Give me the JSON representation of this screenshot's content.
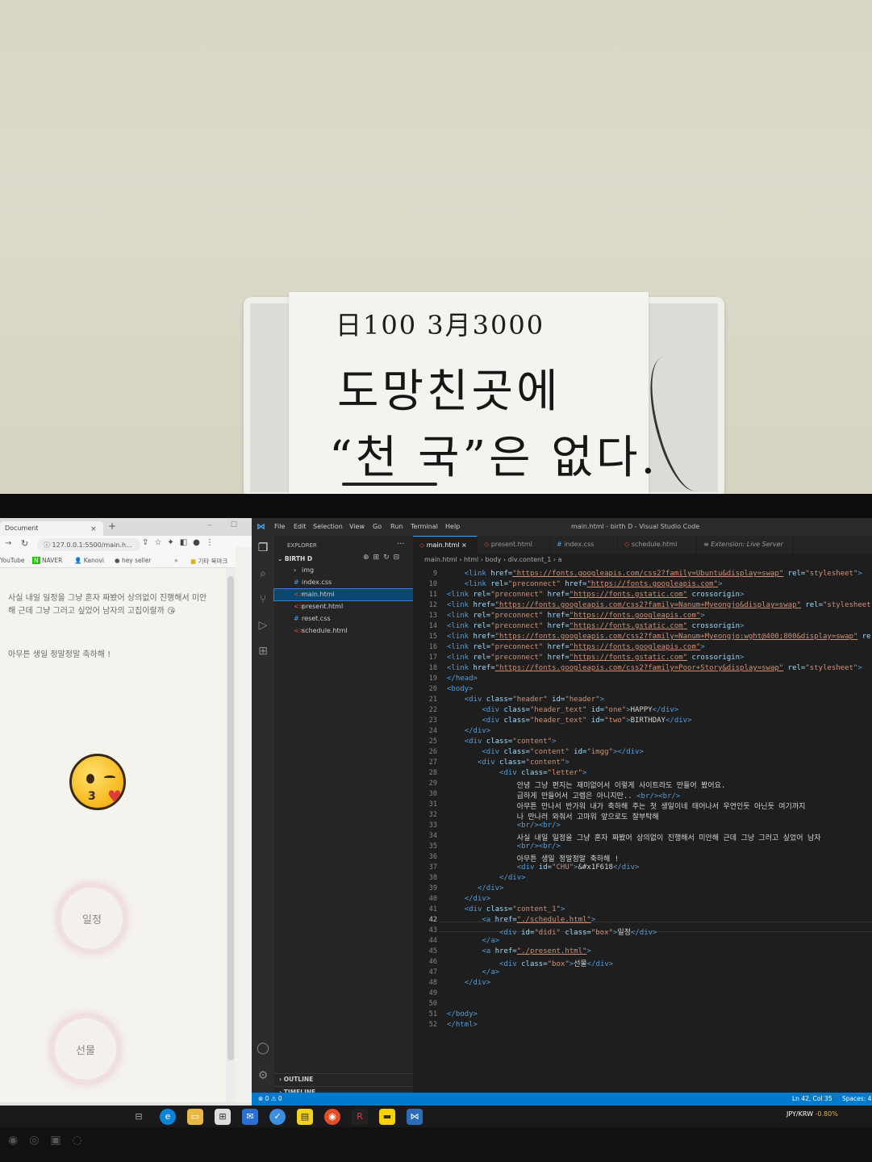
{
  "note": {
    "line1": "日100 3月3000",
    "line2": "도망친곳에",
    "line3": "“천 국”은 없다."
  },
  "browser": {
    "tab_title": "Document",
    "tab_close": "×",
    "new_tab": "+",
    "url": "127.0.0.1:5500/main.h...",
    "bookmarks": [
      "YouTube",
      "NAVER",
      "Kanovi",
      "hey seller",
      "»",
      "기타 북마크"
    ],
    "letter_line1": "사실 내일 일정을 그냥 혼자 짜봤어 상의없이 진행해서 미안해 근데 그냥 그러고 싶었어 남자의 고집이랄까 😘",
    "letter_line2": "아무튼 생일 정말정말 축하해 !",
    "btn_schedule": "일정",
    "btn_present": "선물"
  },
  "vscode": {
    "menu": [
      "File",
      "Edit",
      "Selection",
      "View",
      "Go",
      "Run",
      "Terminal",
      "Help"
    ],
    "window_title": "main.html - birth D - Visual Studio Code",
    "explorer_header": "EXPLORER",
    "explorer_more": "···",
    "folder_name": "BIRTH D",
    "files": [
      {
        "name": "img",
        "icon": "›",
        "kind": "folder"
      },
      {
        "name": "index.css",
        "icon": "#",
        "kind": "css"
      },
      {
        "name": "main.html",
        "icon": "<>",
        "kind": "html"
      },
      {
        "name": "present.html",
        "icon": "<>",
        "kind": "html"
      },
      {
        "name": "reset.css",
        "icon": "#",
        "kind": "css"
      },
      {
        "name": "schedule.html",
        "icon": "<>",
        "kind": "html"
      }
    ],
    "outline_label": "OUTLINE",
    "timeline_label": "TIMELINE",
    "tabs": [
      "main.html",
      "present.html",
      "index.css",
      "schedule.html",
      "Extension: Live Server"
    ],
    "breadcrumb": "main.html › html › body › div.content_1 › a",
    "status_errors": "⊗ 0 ⚠ 0",
    "status_position": "Ln 42, Col 35",
    "status_spaces": "Spaces: 4",
    "code_lines": [
      {
        "n": "9",
        "parts": [
          [
            "ind",
            "    "
          ],
          [
            "tag",
            "<link "
          ],
          [
            "attr",
            "href="
          ],
          [
            "url",
            "\"https://fonts.googleapis.com/css2?family=Ubuntu&display=swap\""
          ],
          [
            "attr",
            " rel="
          ],
          [
            "str",
            "\"stylesheet\""
          ],
          [
            "tag",
            ">"
          ]
        ]
      },
      {
        "n": "10",
        "parts": [
          [
            "ind",
            "    "
          ],
          [
            "tag",
            "<link "
          ],
          [
            "attr",
            "rel="
          ],
          [
            "str",
            "\"preconnect\""
          ],
          [
            "attr",
            " href="
          ],
          [
            "url",
            "\"https://fonts.googleapis.com\""
          ],
          [
            "tag",
            ">"
          ]
        ]
      },
      {
        "n": "11",
        "parts": [
          [
            "tag",
            "<link "
          ],
          [
            "attr",
            "rel="
          ],
          [
            "str",
            "\"preconnect\""
          ],
          [
            "attr",
            " href="
          ],
          [
            "url",
            "\"https://fonts.gstatic.com\""
          ],
          [
            "attr",
            " crossorigin"
          ],
          [
            "tag",
            ">"
          ]
        ]
      },
      {
        "n": "12",
        "parts": [
          [
            "tag",
            "<link "
          ],
          [
            "attr",
            "href="
          ],
          [
            "url",
            "\"https://fonts.googleapis.com/css2?family=Nanum+Myeongjo&display=swap\""
          ],
          [
            "attr",
            " rel="
          ],
          [
            "str",
            "\"stylesheet\""
          ]
        ]
      },
      {
        "n": "13",
        "parts": [
          [
            "tag",
            "<link "
          ],
          [
            "attr",
            "rel="
          ],
          [
            "str",
            "\"preconnect\""
          ],
          [
            "attr",
            " href="
          ],
          [
            "url",
            "\"https://fonts.googleapis.com\""
          ],
          [
            "tag",
            ">"
          ]
        ]
      },
      {
        "n": "14",
        "parts": [
          [
            "tag",
            "<link "
          ],
          [
            "attr",
            "rel="
          ],
          [
            "str",
            "\"preconnect\""
          ],
          [
            "attr",
            " href="
          ],
          [
            "url",
            "\"https://fonts.gstatic.com\""
          ],
          [
            "attr",
            " crossorigin"
          ],
          [
            "tag",
            ">"
          ]
        ]
      },
      {
        "n": "15",
        "parts": [
          [
            "tag",
            "<link "
          ],
          [
            "attr",
            "href="
          ],
          [
            "url",
            "\"https://fonts.googleapis.com/css2?family=Nanum+Myeongjo:wght@400;800&display=swap\""
          ],
          [
            "attr",
            " re"
          ]
        ]
      },
      {
        "n": "16",
        "parts": [
          [
            "tag",
            "<link "
          ],
          [
            "attr",
            "rel="
          ],
          [
            "str",
            "\"preconnect\""
          ],
          [
            "attr",
            " href="
          ],
          [
            "url",
            "\"https://fonts.googleapis.com\""
          ],
          [
            "tag",
            ">"
          ]
        ]
      },
      {
        "n": "17",
        "parts": [
          [
            "tag",
            "<link "
          ],
          [
            "attr",
            "rel="
          ],
          [
            "str",
            "\"preconnect\""
          ],
          [
            "attr",
            " href="
          ],
          [
            "url",
            "\"https://fonts.gstatic.com\""
          ],
          [
            "attr",
            " crossorigin"
          ],
          [
            "tag",
            ">"
          ]
        ]
      },
      {
        "n": "18",
        "parts": [
          [
            "tag",
            "<link "
          ],
          [
            "attr",
            "href="
          ],
          [
            "url",
            "\"https://fonts.googleapis.com/css2?family=Poor+Story&display=swap\""
          ],
          [
            "attr",
            " rel="
          ],
          [
            "str",
            "\"stylesheet\""
          ],
          [
            "tag",
            ">"
          ]
        ]
      },
      {
        "n": "19",
        "parts": [
          [
            "tag",
            "</head>"
          ]
        ]
      },
      {
        "n": "20",
        "parts": [
          [
            "tag",
            "<body>"
          ]
        ]
      },
      {
        "n": "21",
        "parts": [
          [
            "ind",
            "    "
          ],
          [
            "tag",
            "<div "
          ],
          [
            "attr",
            "class="
          ],
          [
            "str",
            "\"header\""
          ],
          [
            "attr",
            " id="
          ],
          [
            "str",
            "\"header\""
          ],
          [
            "tag",
            ">"
          ]
        ]
      },
      {
        "n": "22",
        "parts": [
          [
            "ind",
            "        "
          ],
          [
            "tag",
            "<div "
          ],
          [
            "attr",
            "class="
          ],
          [
            "str",
            "\"header_text\""
          ],
          [
            "attr",
            " id="
          ],
          [
            "str",
            "\"one\""
          ],
          [
            "tag",
            ">"
          ],
          [
            "txt",
            "HAPPY"
          ],
          [
            "tag",
            "</div>"
          ]
        ]
      },
      {
        "n": "23",
        "parts": [
          [
            "ind",
            "        "
          ],
          [
            "tag",
            "<div "
          ],
          [
            "attr",
            "class="
          ],
          [
            "str",
            "\"header_text\""
          ],
          [
            "attr",
            " id="
          ],
          [
            "str",
            "\"two\""
          ],
          [
            "tag",
            ">"
          ],
          [
            "txt",
            "BIRTHDAY"
          ],
          [
            "tag",
            "</div>"
          ]
        ]
      },
      {
        "n": "24",
        "parts": [
          [
            "ind",
            "    "
          ],
          [
            "tag",
            "</div>"
          ]
        ]
      },
      {
        "n": "25",
        "parts": [
          [
            "ind",
            "    "
          ],
          [
            "tag",
            "<div "
          ],
          [
            "attr",
            "class="
          ],
          [
            "str",
            "\"content\""
          ],
          [
            "tag",
            ">"
          ]
        ]
      },
      {
        "n": "26",
        "parts": [
          [
            "ind",
            "        "
          ],
          [
            "tag",
            "<div "
          ],
          [
            "attr",
            "class="
          ],
          [
            "str",
            "\"content\""
          ],
          [
            "attr",
            " id="
          ],
          [
            "str",
            "\"imgg\""
          ],
          [
            "tag",
            "></div>"
          ]
        ]
      },
      {
        "n": "27",
        "parts": [
          [
            "ind",
            "       "
          ],
          [
            "tag",
            "<div "
          ],
          [
            "attr",
            "class="
          ],
          [
            "str",
            "\"content\""
          ],
          [
            "tag",
            ">"
          ]
        ]
      },
      {
        "n": "28",
        "parts": [
          [
            "ind",
            "            "
          ],
          [
            "tag",
            "<div "
          ],
          [
            "attr",
            "class="
          ],
          [
            "str",
            "\"letter\""
          ],
          [
            "tag",
            ">"
          ]
        ]
      },
      {
        "n": "29",
        "parts": [
          [
            "ind",
            "                "
          ],
          [
            "txt",
            "안녕 그냥 편지는 재미없어서 이렇게 사이트라도 만들어 봤어요."
          ]
        ]
      },
      {
        "n": "30",
        "parts": [
          [
            "ind",
            "                "
          ],
          [
            "txt",
            "급하게 만들어서 고렙은 아니지만.. "
          ],
          [
            "tag",
            "<br/><br/>"
          ]
        ]
      },
      {
        "n": "31",
        "parts": [
          [
            "ind",
            "                "
          ],
          [
            "txt",
            "아무튼 만나서 반가워 내가 축하해 주는 첫 생일이네 태어나서 우연인듯 아닌듯 여기까지"
          ]
        ]
      },
      {
        "n": "32",
        "parts": [
          [
            "ind",
            "                "
          ],
          [
            "txt",
            "나 만나러 와줘서 고마워 앞으로도 잘부탁해"
          ]
        ]
      },
      {
        "n": "33",
        "parts": [
          [
            "ind",
            "                "
          ],
          [
            "tag",
            "<br/><br/>"
          ]
        ]
      },
      {
        "n": "34",
        "parts": [
          [
            "ind",
            "                "
          ],
          [
            "txt",
            "사실 내일 일정을 그냥 혼자 짜봤어 상의없이 진행해서 미안해 근데 그냥 그러고 싶었어 남자"
          ]
        ]
      },
      {
        "n": "35",
        "parts": [
          [
            "ind",
            "                "
          ],
          [
            "tag",
            "<br/><br/>"
          ]
        ]
      },
      {
        "n": "36",
        "parts": [
          [
            "ind",
            "                "
          ],
          [
            "txt",
            "아무튼 생일 정말정말 축하해 !"
          ]
        ]
      },
      {
        "n": "37",
        "parts": [
          [
            "ind",
            "                "
          ],
          [
            "tag",
            "<div "
          ],
          [
            "attr",
            "id="
          ],
          [
            "str",
            "\"CHU\""
          ],
          [
            "tag",
            ">"
          ],
          [
            "txt",
            "&#x1F618"
          ],
          [
            "tag",
            "</div>"
          ]
        ]
      },
      {
        "n": "38",
        "parts": [
          [
            "ind",
            "            "
          ],
          [
            "tag",
            "</div>"
          ]
        ]
      },
      {
        "n": "39",
        "parts": [
          [
            "ind",
            "       "
          ],
          [
            "tag",
            "</div>"
          ]
        ]
      },
      {
        "n": "40",
        "parts": [
          [
            "ind",
            "    "
          ],
          [
            "tag",
            "</div>"
          ]
        ]
      },
      {
        "n": "41",
        "parts": [
          [
            "ind",
            "    "
          ],
          [
            "tag",
            "<div "
          ],
          [
            "attr",
            "class="
          ],
          [
            "str",
            "\"content_1\""
          ],
          [
            "tag",
            ">"
          ]
        ]
      },
      {
        "n": "42",
        "parts": [
          [
            "ind",
            "        "
          ],
          [
            "tag",
            "<a "
          ],
          [
            "attr",
            "href="
          ],
          [
            "url",
            "\"./schedule.html\""
          ],
          [
            "tag",
            ">"
          ]
        ]
      },
      {
        "n": "43",
        "parts": [
          [
            "ind",
            "            "
          ],
          [
            "tag",
            "<div "
          ],
          [
            "attr",
            "id="
          ],
          [
            "str",
            "\"didi\""
          ],
          [
            "attr",
            " class="
          ],
          [
            "str",
            "\"box\""
          ],
          [
            "tag",
            ">"
          ],
          [
            "txt",
            "일정"
          ],
          [
            "tag",
            "</div>"
          ]
        ]
      },
      {
        "n": "44",
        "parts": [
          [
            "ind",
            "        "
          ],
          [
            "tag",
            "</a>"
          ]
        ]
      },
      {
        "n": "45",
        "parts": [
          [
            "ind",
            "        "
          ],
          [
            "tag",
            "<a "
          ],
          [
            "attr",
            "href="
          ],
          [
            "url",
            "\"./present.html\""
          ],
          [
            "tag",
            ">"
          ]
        ]
      },
      {
        "n": "46",
        "parts": [
          [
            "ind",
            "            "
          ],
          [
            "tag",
            "<div "
          ],
          [
            "attr",
            "class="
          ],
          [
            "str",
            "\"box\""
          ],
          [
            "tag",
            ">"
          ],
          [
            "txt",
            "선물"
          ],
          [
            "tag",
            "</div>"
          ]
        ]
      },
      {
        "n": "47",
        "parts": [
          [
            "ind",
            "        "
          ],
          [
            "tag",
            "</a>"
          ]
        ]
      },
      {
        "n": "48",
        "parts": [
          [
            "ind",
            "    "
          ],
          [
            "tag",
            "</div>"
          ]
        ]
      },
      {
        "n": "49",
        "parts": []
      },
      {
        "n": "50",
        "parts": []
      },
      {
        "n": "51",
        "parts": [
          [
            "tag",
            "</body>"
          ]
        ]
      },
      {
        "n": "52",
        "parts": [
          [
            "tag",
            "</html>"
          ]
        ]
      }
    ]
  },
  "taskbar": {
    "fx_label": "JPY/KRW",
    "fx_change": "-0.80%"
  },
  "colors": {
    "vscode_blue": "#007acc",
    "selection": "#094771",
    "tag": "#569cd6",
    "attr": "#9cdcfe",
    "string": "#ce9178"
  }
}
